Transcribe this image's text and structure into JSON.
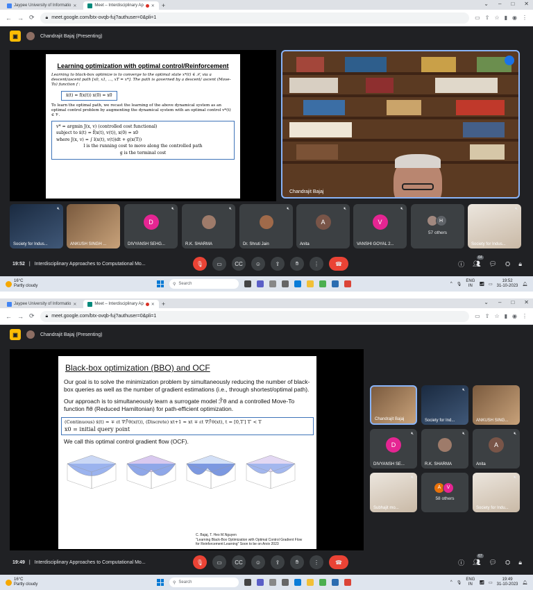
{
  "shots": [
    {
      "tabs": [
        {
          "label": "Jaypee University of Informatio"
        },
        {
          "label": "Meet – Interdisciplinary Ap"
        }
      ],
      "url": "meet.google.com/btx-ovqb-fuj?authuser=0&pli=1",
      "presenting_label": "Chandrajit Bajaj (Presenting)",
      "slide": {
        "title": "Learning optimization with optimal control/Reinforcement",
        "intro": "Learning to black-box optimize is to converge to the optimal state x*(t) ∈ 𝒳, via a descent/ascent path [x0, x1, …, xT = x*]. The path is governed by a descent/ ascent (Move-To) function f :",
        "eq1": "ẋ(t) = f(x(t))      x(0) = x0",
        "body": "To learn the optimal path, we recast the learning of the above dynamical system as an optimal control problem by augmenting the dynamical system with an optimal control v*(t) ∈ 𝒱.",
        "eq2_l1": "v* = argmin J(x, v)  (controlled cost functional)",
        "eq2_l2": "subject to ẋ(t) = f̃(x(t), v(t)),  x(0) = x0",
        "eq2_l3": "where J(x, v) = ∫ l(x(t), v(t))dt + g(x(T))",
        "eq2_l4": "l is the running cost to move along the controlled path",
        "eq2_l5": "g is the terminal cost"
      },
      "speaker_label": "Chandrajit Bajaj",
      "tiles": [
        {
          "name": "Society for Indus..."
        },
        {
          "name": "ANKUSH SINGH ..."
        },
        {
          "name": "DIVYANSH SEHG...",
          "initial": "D",
          "color": "#e52592"
        },
        {
          "name": "R.K. SHARMA"
        },
        {
          "name": "Dr. Shruti Jain"
        },
        {
          "name": "Anita",
          "initial": "A",
          "color": "#795548"
        },
        {
          "name": "VANSHI GOYAL 2...",
          "initial": "V",
          "color": "#e52592"
        },
        {
          "name": "57 others",
          "initial": "H",
          "color": "#5f6368"
        },
        {
          "name": "Society for Indus..."
        }
      ],
      "bottom": {
        "time": "19:52",
        "title": "Interdisciplinary Approaches to Computational Mo...",
        "people_count": "64"
      },
      "taskbar": {
        "temp": "16°C",
        "weather": "Partly cloudy",
        "search": "Search",
        "lang1": "ENG",
        "lang2": "IN",
        "time": "19:52",
        "date": "31-10-2023"
      }
    },
    {
      "tabs": [
        {
          "label": "Jaypee University of Informatio"
        },
        {
          "label": "Meet – Interdisciplinary Ap"
        }
      ],
      "url": "meet.google.com/btx-ovqb-fuj?authuser=0&pli=1",
      "presenting_label": "Chandrajit Bajaj (Presenting)",
      "slide": {
        "title": "Black-box optimization (BBO) and OCF",
        "p1": "Our goal is to solve the minimization problem by simultaneously reducing the number of black-box queries as well as the number of gradient estimations (i.e., through shortest/optimal path).",
        "p2": "Our approach is to simultaneously learn a surrogate model ℱ̃θ and a controlled Move-To function h̃θ (Reduced Hamiltonian) for path-efficient optimization.",
        "eq_a": "(Continuous) ẋ(t) ≈ ∓ εt ∇ℱ̃θ(x(t)),  (Discrete) xt+1 ≈ xt ∓ εt ∇ℱ̃θ(xt), t = [0,T′]  T′ < T",
        "eq_b": "x0 = initial query point",
        "p3": "We call this optimal control gradient flow (OCF).",
        "cite1": "C. Bajaj, T. Heo M.Nguyen",
        "cite2": "\"Learning Black-Box Optimization with Optimal Control Gradient Flow for Reinforcement Learning\" Soon to be on Arxiv 2023"
      },
      "tiles": [
        {
          "name": "Chandrajit Bajaj"
        },
        {
          "name": "Society for Ind..."
        },
        {
          "name": "ANKUSH SING..."
        },
        {
          "name": "DIVYANSH SE...",
          "initial": "D",
          "color": "#e52592"
        },
        {
          "name": "R.K. SHARMA"
        },
        {
          "name": "Anita",
          "initial": "A",
          "color": "#795548"
        },
        {
          "name": "Subhajit mo..."
        },
        {
          "name": "58 others",
          "initial": "A",
          "initial2": "V",
          "color": "#e8710a",
          "color2": "#e52592"
        },
        {
          "name": "Society for Indu..."
        }
      ],
      "bottom": {
        "time": "19:49",
        "title": "Interdisciplinary Approaches to Computational Mo...",
        "people_count": "67"
      },
      "taskbar": {
        "temp": "16°C",
        "weather": "Partly cloudy",
        "search": "Search",
        "lang1": "ENG",
        "lang2": "IN",
        "time": "19:49",
        "date": "31-10-2023"
      }
    }
  ]
}
